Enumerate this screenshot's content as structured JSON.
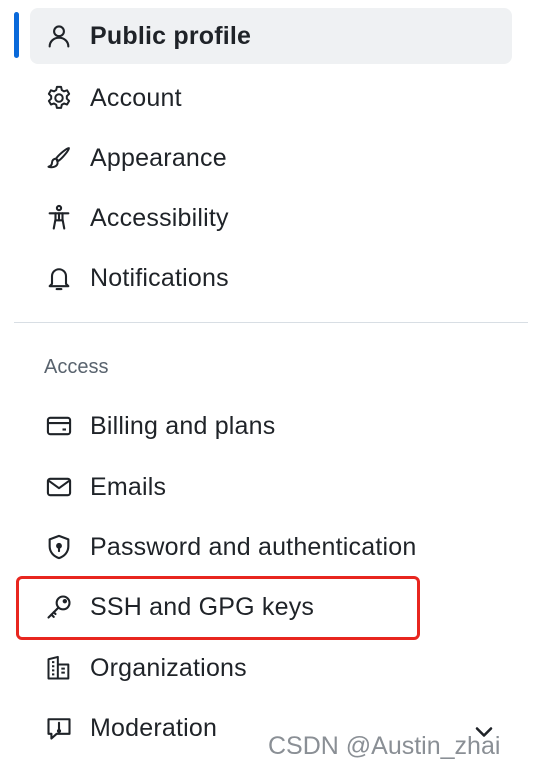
{
  "nav": {
    "items": [
      {
        "label": "Public profile",
        "icon": "person-icon"
      },
      {
        "label": "Account",
        "icon": "gear-icon"
      },
      {
        "label": "Appearance",
        "icon": "paintbrush-icon"
      },
      {
        "label": "Accessibility",
        "icon": "accessibility-icon"
      },
      {
        "label": "Notifications",
        "icon": "bell-icon"
      }
    ],
    "section_heading": "Access",
    "access_items": [
      {
        "label": "Billing and plans",
        "icon": "credit-card-icon"
      },
      {
        "label": "Emails",
        "icon": "mail-icon"
      },
      {
        "label": "Password and authentication",
        "icon": "shield-lock-icon"
      },
      {
        "label": "SSH and GPG keys",
        "icon": "key-icon"
      },
      {
        "label": "Organizations",
        "icon": "organization-icon"
      },
      {
        "label": "Moderation",
        "icon": "report-icon"
      }
    ],
    "active_item": "Public profile",
    "highlighted_item": "SSH and GPG keys"
  },
  "watermark": "CSDN @Austin_zhai",
  "colors": {
    "accent": "#0969da",
    "active_bg": "#eff1f3",
    "highlight": "#e8261f",
    "text": "#1f2328",
    "muted": "#59636e"
  }
}
